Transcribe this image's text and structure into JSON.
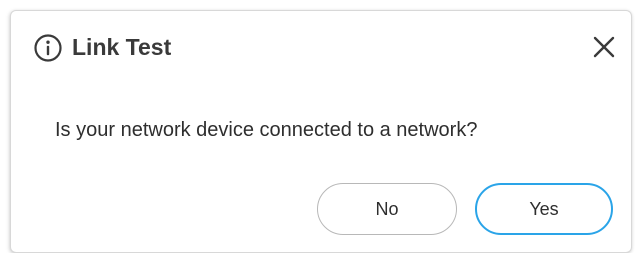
{
  "dialog": {
    "title": "Link Test",
    "message": "Is your network device connected to a network?",
    "buttons": {
      "no_label": "No",
      "yes_label": "Yes"
    },
    "icons": {
      "header_icon": "info-circle-icon",
      "close_icon": "close-icon"
    },
    "colors": {
      "primary_accent": "#2aa4e8",
      "secondary_border": "#b8b8b8",
      "text": "#2e2e2e"
    }
  }
}
